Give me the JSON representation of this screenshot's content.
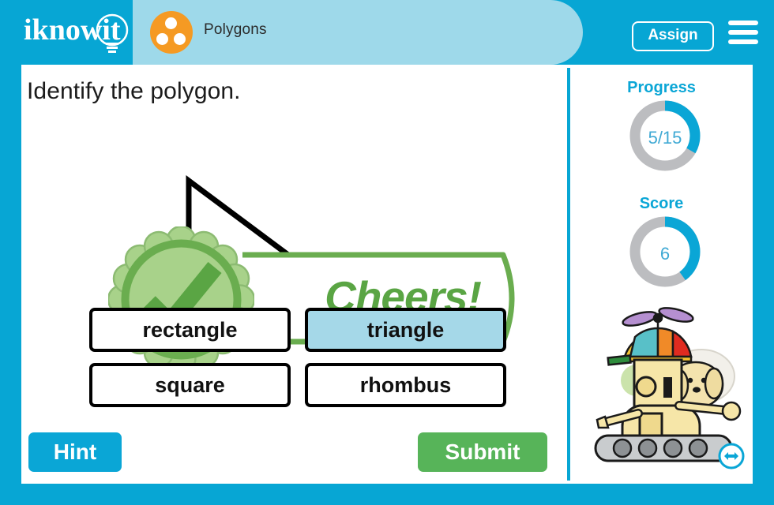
{
  "header": {
    "logo_text": "iknowit",
    "logo_icon": "lightbulb-icon",
    "topic_icon": "three-dots-circle-icon",
    "topic_label": "Polygons",
    "assign_label": "Assign",
    "menu_icon": "hamburger-menu-icon",
    "bg_color": "#07a6d4",
    "pill_color": "#9ed9ea",
    "badge_color": "#f59a23"
  },
  "main": {
    "question": "Identify the polygon.",
    "figure": {
      "name": "right-triangle-outline",
      "stroke_color": "#000000"
    },
    "feedback": {
      "text": "Cheers!",
      "badge_icon": "green-check-rosette-icon",
      "color": "#5aa544",
      "badge_fill": "#a8d28a",
      "badge_ring": "#6aad4f"
    },
    "options": [
      {
        "label": "rectangle",
        "selected": false
      },
      {
        "label": "triangle",
        "selected": true
      },
      {
        "label": "square",
        "selected": false
      },
      {
        "label": "rhombus",
        "selected": false
      }
    ],
    "selected_color": "#a5d8e8",
    "hint_label": "Hint",
    "submit_label": "Submit",
    "hint_color": "#0aa6d6",
    "submit_color": "#57b459"
  },
  "sidebar": {
    "progress": {
      "title": "Progress",
      "value": "5/15",
      "fraction": 0.333,
      "arc_color": "#0aa6d6",
      "track_color": "#bcbdc0"
    },
    "score": {
      "title": "Score",
      "value": "6",
      "fraction": 0.4,
      "arc_color": "#0aa6d6",
      "track_color": "#bcbdc0"
    },
    "mascot_icon": "robot-with-propeller-hat-and-dog",
    "next_icon": "left-right-arrow-circle-icon"
  }
}
